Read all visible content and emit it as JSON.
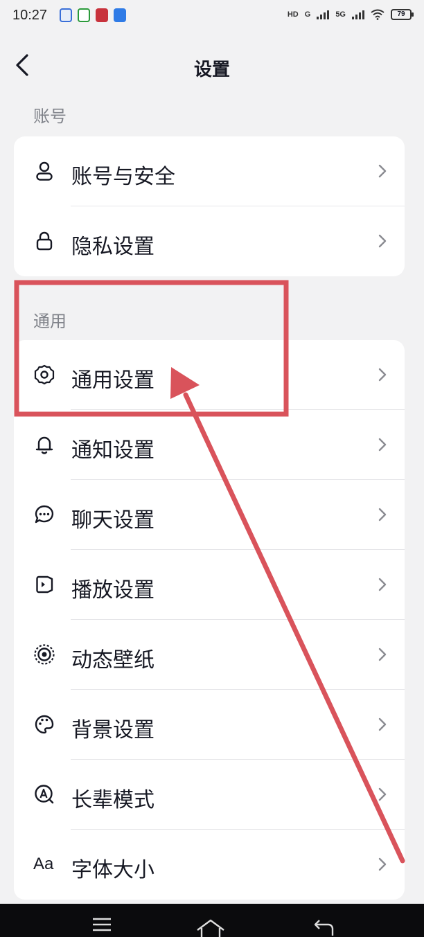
{
  "status_bar": {
    "time": "10:27",
    "network_hd": "HD",
    "network_g": "G",
    "network_5g": "5G",
    "battery": "79"
  },
  "header": {
    "title": "设置"
  },
  "sections": {
    "account": {
      "title": "账号",
      "items": [
        {
          "label": "账号与安全",
          "icon": "person-icon"
        },
        {
          "label": "隐私设置",
          "icon": "lock-icon"
        }
      ]
    },
    "general": {
      "title": "通用",
      "items": [
        {
          "label": "通用设置",
          "icon": "gear-icon"
        },
        {
          "label": "通知设置",
          "icon": "bell-icon"
        },
        {
          "label": "聊天设置",
          "icon": "chat-bubble-icon"
        },
        {
          "label": "播放设置",
          "icon": "play-icon"
        },
        {
          "label": "动态壁纸",
          "icon": "wallpaper-icon"
        },
        {
          "label": "背景设置",
          "icon": "palette-icon"
        },
        {
          "label": "长辈模式",
          "icon": "elder-mode-icon"
        },
        {
          "label": "字体大小",
          "icon": "font-size-icon",
          "icon_text": "Aa"
        }
      ]
    }
  },
  "annotation": {
    "highlight_target": "通用设置",
    "color": "#d9535b"
  },
  "colors": {
    "background": "#f2f2f3",
    "card": "#ffffff",
    "section_text": "#80838a",
    "primary_text": "#161823"
  }
}
